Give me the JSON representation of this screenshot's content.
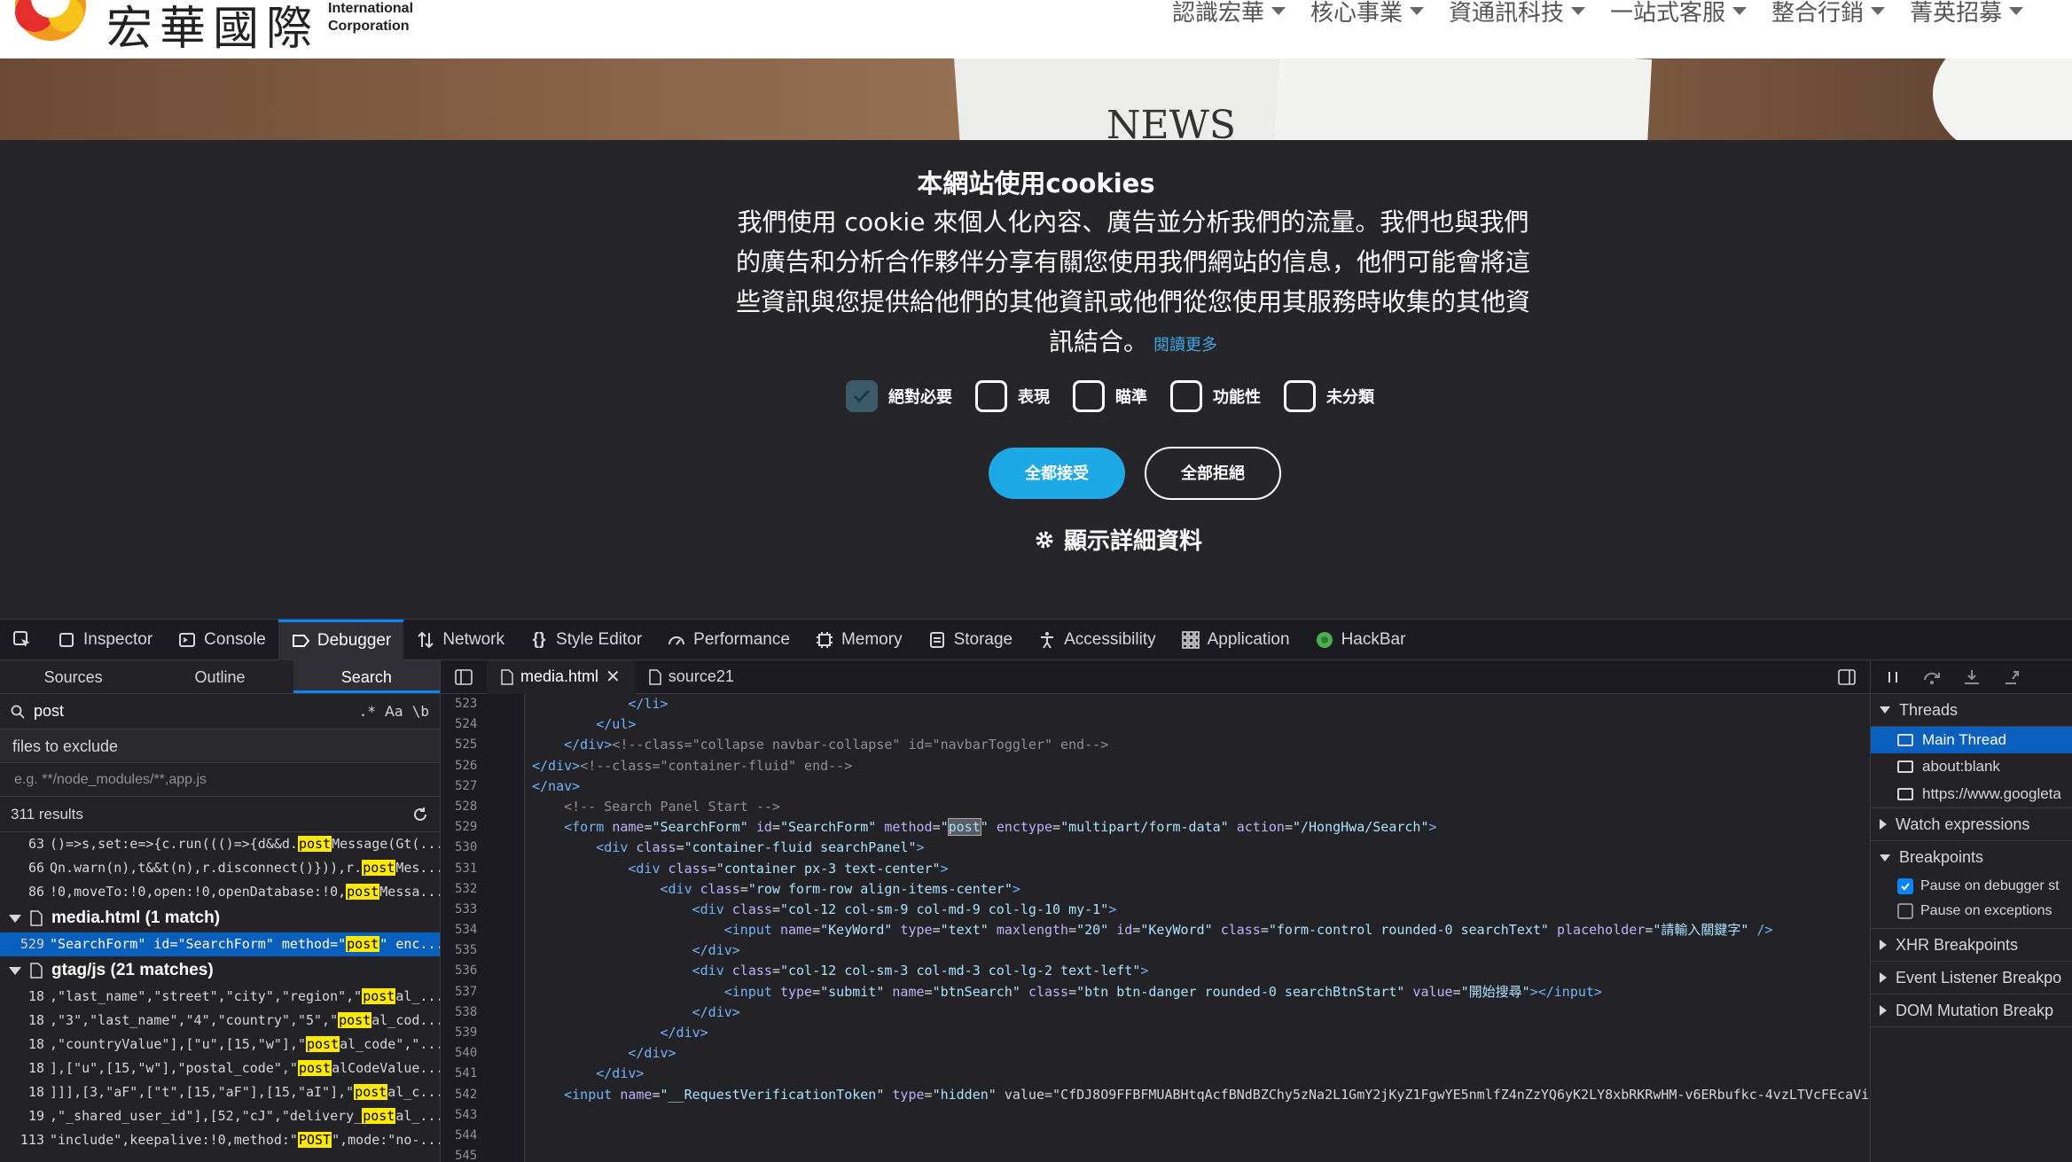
{
  "site": {
    "logo_cn": "宏華國際",
    "logo_en": [
      "International",
      "Corporation"
    ],
    "nav": [
      "認識宏華",
      "核心事業",
      "資通訊科技",
      "一站式客服",
      "整合行銷",
      "菁英招募"
    ],
    "banner_text": "NEWS"
  },
  "cookie": {
    "title": "本網站使用cookies",
    "body": "我們使用 cookie 來個人化內容、廣告並分析我們的流量。我們也與我們的廣告和分析合作夥伴分享有關您使用我們網站的信息，他們可能會將這些資訊與您提供給他們的其他資訊或他們從您使用其服務時收集的其他資訊結合。",
    "read_more": "閱讀更多",
    "options": [
      {
        "label": "絕對必要",
        "checked": true
      },
      {
        "label": "表現",
        "checked": false
      },
      {
        "label": "瞄準",
        "checked": false
      },
      {
        "label": "功能性",
        "checked": false
      },
      {
        "label": "未分類",
        "checked": false
      }
    ],
    "accept_all": "全都接受",
    "reject_all": "全部拒絕",
    "show_details": "顯示詳細資料"
  },
  "devtools": {
    "tabs": [
      "Inspector",
      "Console",
      "Debugger",
      "Network",
      "Style Editor",
      "Performance",
      "Memory",
      "Storage",
      "Accessibility",
      "Application",
      "HackBar"
    ],
    "selected_tab": "Debugger",
    "left_tabs": [
      "Sources",
      "Outline",
      "Search"
    ],
    "search_value": "post",
    "search_opts": [
      ".*",
      "Aa",
      "\\b"
    ],
    "files_to_exclude": "files to exclude",
    "exclude_placeholder": "e.g. **/node_modules/**,app.js",
    "results_count": "311 results",
    "results": [
      {
        "type": "line",
        "ln": "63",
        "pre": "()=>s,set:e=>{c.run((()=>{d&&d.",
        "match": "post",
        "post": "Message(Gt(..."
      },
      {
        "type": "line",
        "ln": "66",
        "pre": "Qn.warn(n),t&&t(n),r.disconnect()})),r.",
        "match": "post",
        "post": "Mes..."
      },
      {
        "type": "line",
        "ln": "86",
        "pre": "!0,moveTo:!0,open:!0,openDatabase:!0,",
        "match": "post",
        "post": "Messa..."
      },
      {
        "type": "file",
        "name": "media.html (1 match)"
      },
      {
        "type": "line",
        "ln": "529",
        "pre": "\"SearchForm\" id=\"SearchForm\" method=\"",
        "match": "post",
        "post": "\" enc...",
        "selected": true
      },
      {
        "type": "file",
        "name": "gtag/js (21 matches)"
      },
      {
        "type": "line",
        "ln": "18",
        "pre": ",\"last_name\",\"street\",\"city\",\"region\",\"",
        "match": "post",
        "post": "al_..."
      },
      {
        "type": "line",
        "ln": "18",
        "pre": ",\"3\",\"last_name\",\"4\",\"country\",\"5\",\"",
        "match": "post",
        "post": "al_cod..."
      },
      {
        "type": "line",
        "ln": "18",
        "pre": ",\"countryValue\"],[\"u\",[15,\"w\"],\"",
        "match": "post",
        "post": "al_code\",\"..."
      },
      {
        "type": "line",
        "ln": "18",
        "pre": "],[\"u\",[15,\"w\"],\"postal_code\",\"",
        "match": "post",
        "post": "alCodeValue..."
      },
      {
        "type": "line",
        "ln": "18",
        "pre": "]]],[3,\"aF\",[\"t\",[15,\"aF\"],[15,\"aI\"],\"",
        "match": "post",
        "post": "al_c..."
      },
      {
        "type": "line",
        "ln": "19",
        "pre": ",\"_shared_user_id\"],[52,\"cJ\",\"delivery_",
        "match": "post",
        "post": "al_..."
      },
      {
        "type": "line",
        "ln": "113",
        "pre": "\"include\",keepalive:!0,method:\"",
        "match": "POST",
        "post": "\",mode:\"no-..."
      }
    ],
    "source_tabs": [
      "media.html",
      "source21"
    ],
    "code_start": 523,
    "code": [
      "            </li>",
      "        </ul>",
      "    </div><!--class=\"collapse navbar-collapse\" id=\"navbarToggler\" end-->",
      "</div><!--class=\"container-fluid\" end-->",
      "</nav>",
      "    <!-- Search Panel Start -->",
      "    <form name=\"SearchForm\" id=\"SearchForm\" method=\"post\" enctype=\"multipart/form-data\" action=\"/HongHwa/Search\">",
      "        <div class=\"container-fluid searchPanel\">",
      "            <div class=\"container px-3 text-center\">",
      "                <div class=\"row form-row align-items-center\">",
      "                    <div class=\"col-12 col-sm-9 col-md-9 col-lg-10 my-1\">",
      "                        <input name=\"KeyWord\" type=\"text\" maxlength=\"20\" id=\"KeyWord\" class=\"form-control rounded-0 searchText\" placeholder=\"請輸入關鍵字\" />",
      "                    </div>",
      "                    <div class=\"col-12 col-sm-3 col-md-3 col-lg-2 text-left\">",
      "                        <input type=\"submit\" name=\"btnSearch\" class=\"btn btn-danger rounded-0 searchBtnStart\" value=\"開始搜尋\"></input>",
      "                    </div>",
      "                </div>",
      "            </div>",
      "        </div>",
      "    <input name=\"__RequestVerificationToken\" type=\"hidden\" value=\"CfDJ8O9FFBFMUABHtqAcfBNdBZChy5zNa2L1GmY2jKyZ1FgwYE5nmlfZ4nZzYQ6yK2LY8xbRKRwHM-v6ERbufkc-4vzLTVcFEcaVi",
      "",
      "",
      ""
    ],
    "right": {
      "threads_label": "Threads",
      "threads": [
        "Main Thread",
        "about:blank",
        "https://www.googleta"
      ],
      "watch": "Watch expressions",
      "breakpoints": "Breakpoints",
      "pause_debugger": "Pause on debugger st",
      "pause_exceptions": "Pause on exceptions",
      "xhr": "XHR Breakpoints",
      "event": "Event Listener Breakpo",
      "dom": "DOM Mutation Breakp"
    }
  },
  "colors": {
    "accent": "#0a84ff",
    "cookie_accept": "#1da9e6",
    "match_highlight": "#ffe900"
  }
}
